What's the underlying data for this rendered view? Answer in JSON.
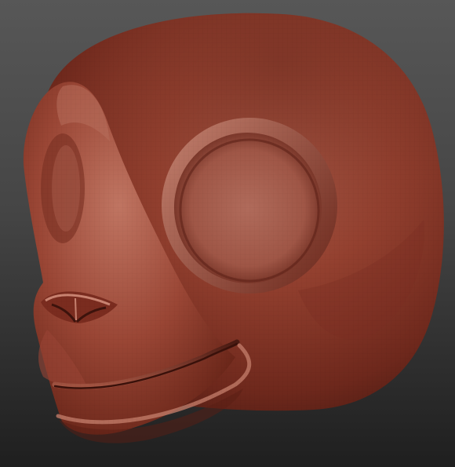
{
  "scene": {
    "background_top_color": "#575757",
    "background_bottom_color": "#1f1f1f",
    "material_color": "#8f3a2c",
    "material_highlight_color": "#c27a68",
    "material_shadow_color": "#4a1a12"
  }
}
